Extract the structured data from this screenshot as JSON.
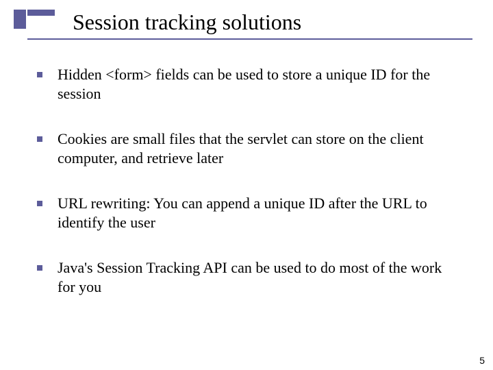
{
  "title": "Session tracking solutions",
  "bullets": [
    "Hidden <form> fields can be used to store a unique ID for the session",
    "Cookies are small files that the servlet can store on the client computer, and retrieve later",
    "URL rewriting: You can append a unique ID after the URL to identify the user",
    "Java's Session Tracking API can be used to do most of the work for you"
  ],
  "page_number": "5"
}
